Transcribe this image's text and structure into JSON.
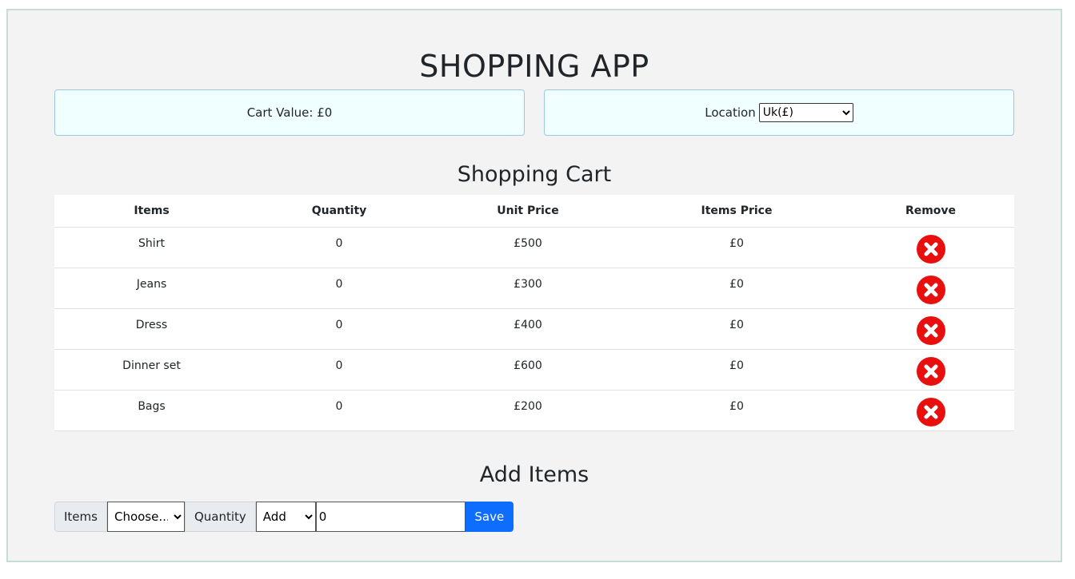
{
  "app": {
    "title": "SHOPPING APP"
  },
  "cart_value": {
    "label": "Cart Value: £0"
  },
  "location": {
    "label": "Location",
    "selected": "Uk(£)"
  },
  "cart": {
    "title": "Shopping Cart",
    "headers": [
      "Items",
      "Quantity",
      "Unit Price",
      "Items Price",
      "Remove"
    ],
    "rows": [
      {
        "item": "Shirt",
        "quantity": "0",
        "unit_price": "£500",
        "items_price": "£0"
      },
      {
        "item": "Jeans",
        "quantity": "0",
        "unit_price": "£300",
        "items_price": "£0"
      },
      {
        "item": "Dress",
        "quantity": "0",
        "unit_price": "£400",
        "items_price": "£0"
      },
      {
        "item": "Dinner set",
        "quantity": "0",
        "unit_price": "£600",
        "items_price": "£0"
      },
      {
        "item": "Bags",
        "quantity": "0",
        "unit_price": "£200",
        "items_price": "£0"
      }
    ],
    "remove_icon": "remove-circle-x-icon",
    "remove_color": "#e8100f"
  },
  "add_items": {
    "title": "Add Items",
    "items_label": "Items",
    "items_selected": "Choose...",
    "quantity_label": "Quantity",
    "action_selected": "Add",
    "quantity_value": "0",
    "save_label": "Save",
    "save_color": "#0d6efd"
  }
}
